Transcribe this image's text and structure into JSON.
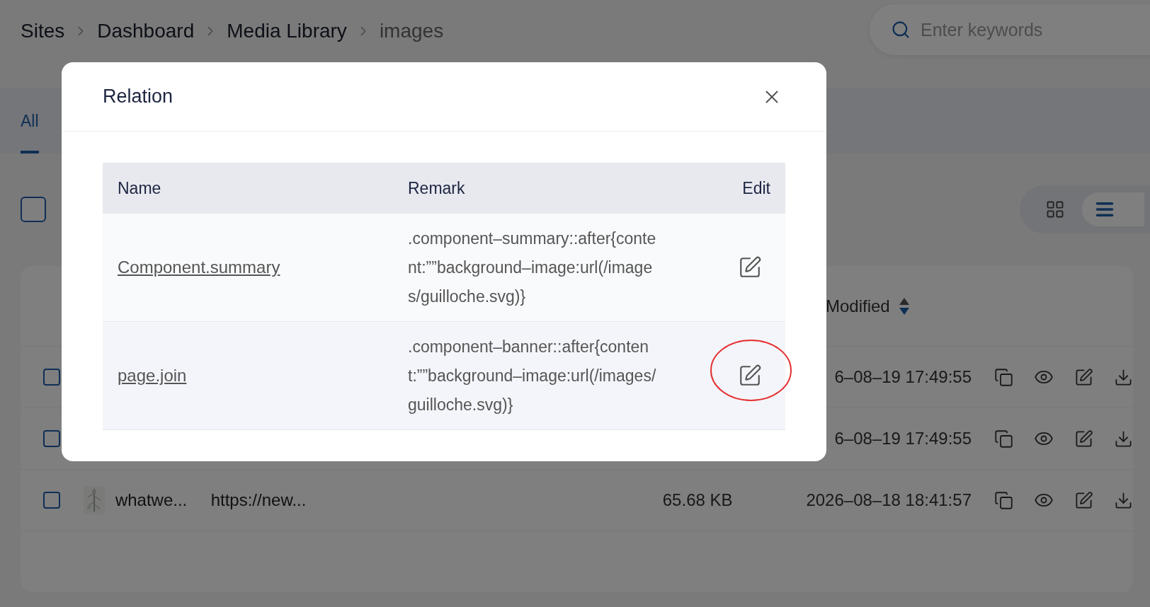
{
  "breadcrumb": [
    {
      "label": "Sites",
      "current": false
    },
    {
      "label": "Dashboard",
      "current": false
    },
    {
      "label": "Media Library",
      "current": false
    },
    {
      "label": "images",
      "current": true
    }
  ],
  "search": {
    "placeholder": "Enter keywords"
  },
  "tabs": [
    {
      "label": "All",
      "selected": true
    }
  ],
  "select_all": {
    "checked": false
  },
  "view_toggle": [
    {
      "kind": "grid",
      "selected": false
    },
    {
      "kind": "list",
      "selected": true
    }
  ],
  "table": {
    "columns": [
      {
        "label": "Modified"
      }
    ],
    "rows": [
      {
        "checked": false,
        "modified": "6–08–19 17:49:55"
      },
      {
        "checked": false,
        "modified": "6–08–19 17:49:55"
      },
      {
        "checked": false,
        "thumbnail": true,
        "name": "whatwe...",
        "url": "https://new...",
        "size": "65.68 KB",
        "modified": "2026–08–18 18:41:57"
      }
    ]
  },
  "dialog": {
    "title": "Relation",
    "columns": [
      "Name",
      "Remark",
      "Edit"
    ],
    "rows": [
      {
        "name": "Component.summary",
        "remark": ".component–summary::after{content:””background–image:url(/images/guilloche.svg)}"
      },
      {
        "name": "page.join",
        "remark": ".component–banner::after{content:””background–image:url(/images/guilloche.svg)}"
      }
    ]
  }
}
